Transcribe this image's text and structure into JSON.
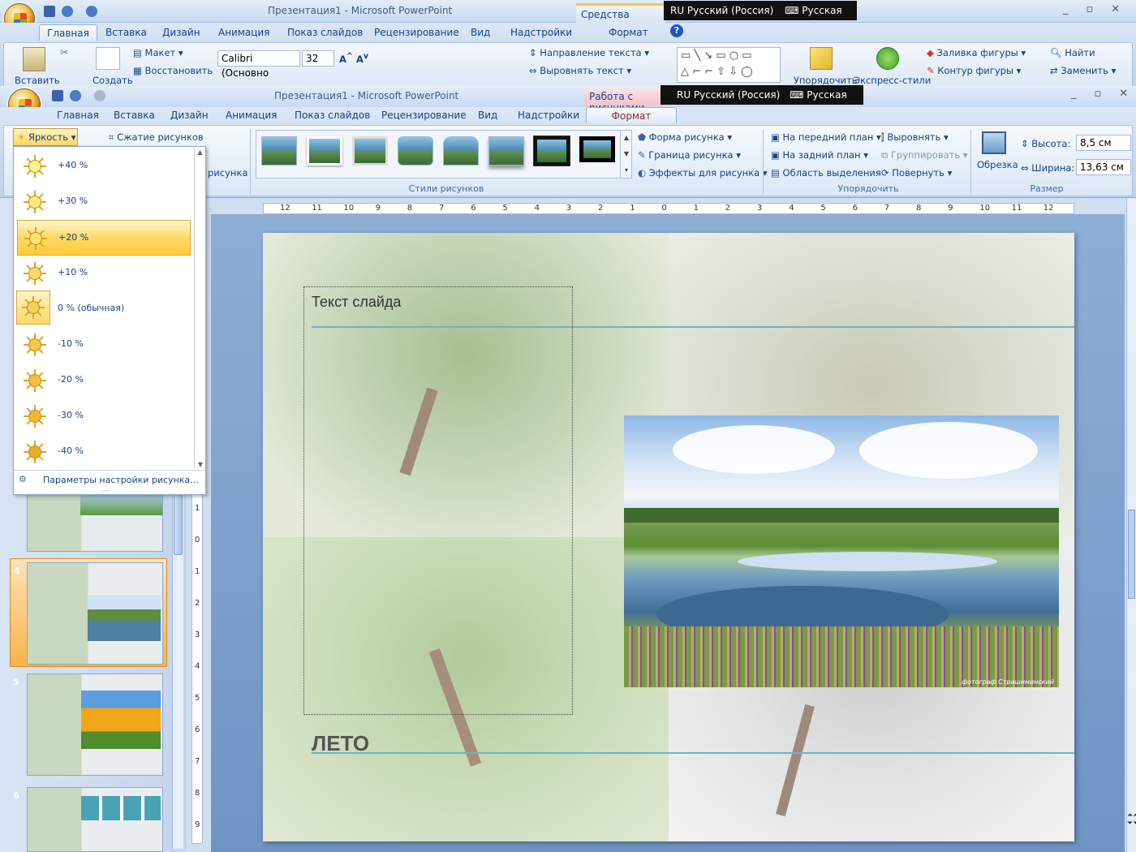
{
  "back_window": {
    "title": "Презентация1 - Microsoft PowerPoint",
    "context_tab": "Средства рисования",
    "tabs": [
      "Главная",
      "Вставка",
      "Дизайн",
      "Анимация",
      "Показ слайдов",
      "Рецензирование",
      "Вид",
      "Надстройки",
      "Формат"
    ],
    "paste": "Вставить",
    "create": "Создать",
    "layout": "Макет",
    "restore": "Восстановить",
    "font": "Calibri (Основно",
    "size": "32",
    "text_dir": "Направление текста",
    "align_text": "Выровнять текст",
    "arrange": "Упорядочить",
    "quick_styles": "Экспресс-стили",
    "fill": "Заливка фигуры",
    "outline": "Контур фигуры",
    "find": "Найти",
    "replace": "Заменить"
  },
  "lang_bar": {
    "lang": "RU Русский (Россия)",
    "kb": "Русская",
    "help": "?"
  },
  "front_window": {
    "title": "Презентация1 - Microsoft PowerPoint",
    "context_tab": "Работа с рисунками",
    "tabs": [
      "Главная",
      "Вставка",
      "Дизайн",
      "Анимация",
      "Показ слайдов",
      "Рецензирование",
      "Вид",
      "Надстройки",
      "Формат"
    ]
  },
  "ribbon": {
    "brightness": "Яркость",
    "compress": "Сжатие рисунков",
    "recolor_partial": "рисунка",
    "styles_group": "Стили рисунков",
    "shape": "Форма рисунка",
    "border": "Граница рисунка",
    "effects": "Эффекты для рисунка",
    "bring_front": "На передний план",
    "send_back": "На задний план",
    "selection": "Область выделения",
    "align": "Выровнять",
    "group": "Группировать",
    "rotate": "Повернуть",
    "arrange_group": "Упорядочить",
    "crop": "Обрезка",
    "height_label": "Высота:",
    "height_value": "8,5 см",
    "width_label": "Ширина:",
    "width_value": "13,63 см",
    "size_group": "Размер"
  },
  "ruler_labels": [
    "12",
    "11",
    "10",
    "9",
    "8",
    "7",
    "6",
    "5",
    "4",
    "3",
    "2",
    "1",
    "0",
    "1",
    "2",
    "3",
    "4",
    "5",
    "6",
    "7",
    "8",
    "9",
    "10",
    "11",
    "12"
  ],
  "vruler_labels": [
    "1",
    "0",
    "1",
    "2",
    "3",
    "4",
    "5",
    "6",
    "7",
    "8",
    "9"
  ],
  "brightness_menu": {
    "items": [
      "+40 %",
      "+30 %",
      "+20 %",
      "+10 %",
      "0 % (обычная)",
      "-10 %",
      "-20 %",
      "-30 %",
      "-40 %"
    ],
    "highlighted": "+20 %",
    "selected": "0 % (обычная)",
    "footer": "Параметры настройки рисунка..."
  },
  "slides": [
    {
      "num": "4"
    },
    {
      "num": "5"
    },
    {
      "num": "6"
    }
  ],
  "slide": {
    "text_placeholder": "Текст слайда",
    "title": "ЛЕТО",
    "caption": "фотограф Страшиминский"
  }
}
